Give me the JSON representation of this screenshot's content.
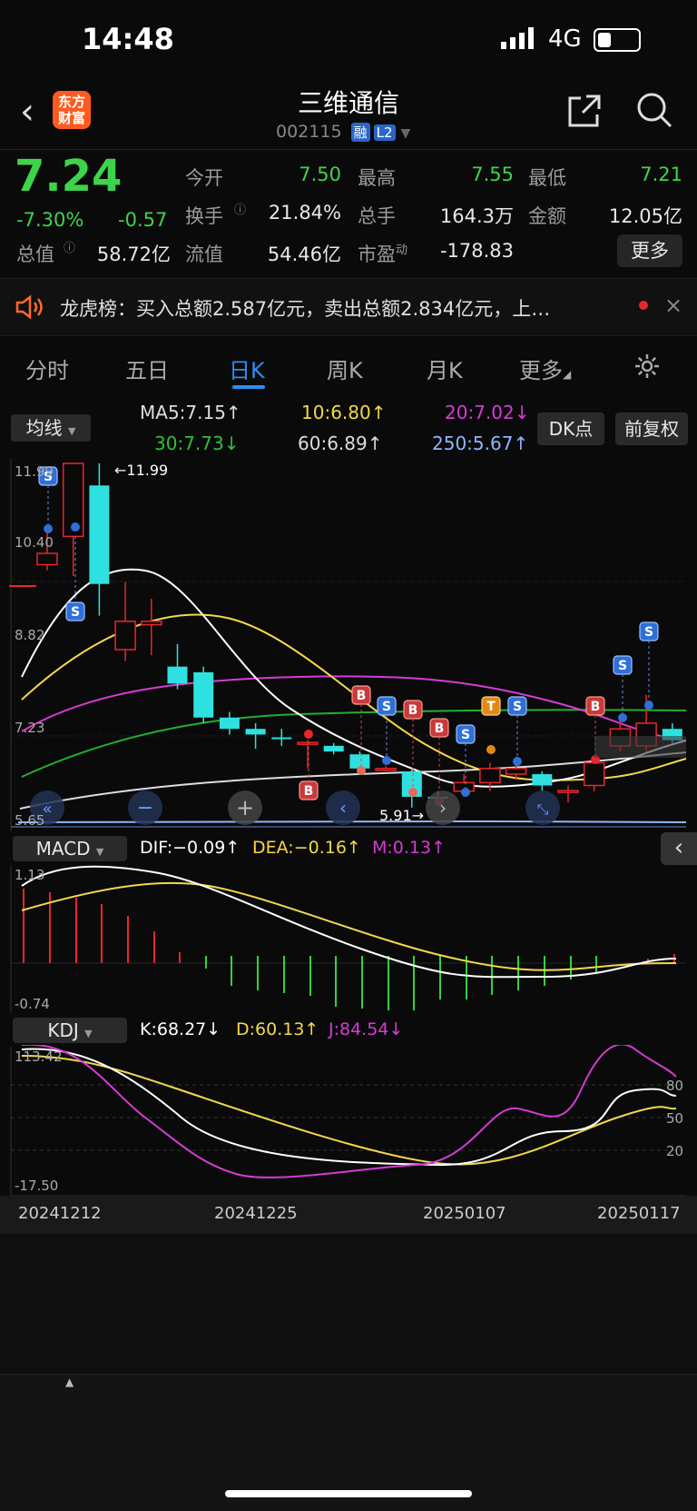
{
  "status": {
    "time": "14:48",
    "network": "4G"
  },
  "header": {
    "logo_text": "东方财富",
    "stock_name": "三维通信",
    "stock_code": "002115",
    "tag_margin": "融",
    "tag_level": "L2"
  },
  "quote": {
    "price": "7.24",
    "change_pct": "-7.30%",
    "change": "-0.57",
    "open_label": "今开",
    "open": "7.50",
    "high_label": "最高",
    "high": "7.55",
    "low_label": "最低",
    "low": "7.21",
    "turnover_label": "换手",
    "turnover": "21.84%",
    "volume_label": "总手",
    "volume": "164.3万",
    "amount_label": "金额",
    "amount": "12.05亿",
    "mktcap_label": "总值",
    "mktcap": "58.72亿",
    "float_label": "流值",
    "float": "54.46亿",
    "pe_label": "市盈",
    "pe_sup": "动",
    "pe": "-178.83",
    "more": "更多"
  },
  "notice": {
    "text": "龙虎榜：买入总额2.587亿元，卖出总额2.834亿元，上…"
  },
  "tabs": [
    {
      "label": "分时"
    },
    {
      "label": "五日"
    },
    {
      "label": "日K"
    },
    {
      "label": "周K"
    },
    {
      "label": "月K"
    },
    {
      "label": "更多"
    }
  ],
  "kchart": {
    "ma_selector": "均线",
    "ma5": "MA5:7.15↑",
    "ma10": "10:6.80↑",
    "ma20": "20:7.02↓",
    "ma30": "30:7.73↓",
    "ma60": "60:6.89↑",
    "ma250": "250:5.67↑",
    "dk_button": "DK点",
    "adjust_button": "前复权",
    "y_labels": [
      "11.99",
      "10.40",
      "8.82",
      "7.23",
      "5.65"
    ],
    "max_note": "←11.99",
    "min_note": "5.91→"
  },
  "macd": {
    "selector": "MACD",
    "dif": "DIF:−0.09↑",
    "dea": "DEA:−0.16↑",
    "m": "M:0.13↑",
    "y_top": "1.13",
    "y_bottom": "-0.74"
  },
  "kdj": {
    "selector": "KDJ",
    "k": "K:68.27↓",
    "d": "D:60.13↑",
    "j": "J:84.54↓",
    "y_top": "113.42",
    "y_bottom": "-17.50",
    "levels": [
      "80",
      "50",
      "20"
    ]
  },
  "dates": [
    "20241212",
    "20241225",
    "20250107",
    "20250117"
  ],
  "chart_data": {
    "type": "candlestick",
    "ylim": [
      5.65,
      11.99
    ],
    "candles": [
      {
        "o": 10.2,
        "c": 10.4,
        "h": 10.9,
        "l": 10.1
      },
      {
        "o": 10.7,
        "c": 11.99,
        "h": 11.99,
        "l": 10.0
      },
      {
        "o": 11.6,
        "c": 9.86,
        "h": 11.99,
        "l": 9.3
      },
      {
        "o": 8.7,
        "c": 9.2,
        "h": 9.9,
        "l": 8.5
      },
      {
        "o": 9.14,
        "c": 9.2,
        "h": 9.6,
        "l": 8.6
      },
      {
        "o": 8.4,
        "c": 8.1,
        "h": 8.8,
        "l": 8.0
      },
      {
        "o": 8.3,
        "c": 7.5,
        "h": 8.4,
        "l": 7.4
      },
      {
        "o": 7.5,
        "c": 7.3,
        "h": 7.6,
        "l": 7.2
      },
      {
        "o": 7.3,
        "c": 7.2,
        "h": 7.4,
        "l": 6.95
      },
      {
        "o": 7.15,
        "c": 7.14,
        "h": 7.3,
        "l": 7.0
      },
      {
        "o": 7.06,
        "c": 7.06,
        "h": 7.1,
        "l": 6.6
      },
      {
        "o": 7.0,
        "c": 6.9,
        "h": 7.05,
        "l": 6.85
      },
      {
        "o": 6.85,
        "c": 6.6,
        "h": 6.9,
        "l": 6.5
      },
      {
        "o": 6.6,
        "c": 6.6,
        "h": 6.65,
        "l": 6.55
      },
      {
        "o": 6.55,
        "c": 6.1,
        "h": 6.6,
        "l": 5.91
      },
      {
        "o": 6.1,
        "c": 6.08,
        "h": 6.2,
        "l": 6.0
      },
      {
        "o": 6.2,
        "c": 6.35,
        "h": 6.5,
        "l": 6.1
      },
      {
        "o": 6.35,
        "c": 6.6,
        "h": 6.7,
        "l": 6.2
      },
      {
        "o": 6.5,
        "c": 6.6,
        "h": 6.8,
        "l": 6.4
      },
      {
        "o": 6.5,
        "c": 6.3,
        "h": 6.55,
        "l": 6.2
      },
      {
        "o": 6.2,
        "c": 6.21,
        "h": 6.3,
        "l": 6.0
      },
      {
        "o": 6.3,
        "c": 6.7,
        "h": 6.8,
        "l": 6.2
      },
      {
        "o": 7.0,
        "c": 7.3,
        "h": 7.5,
        "l": 6.9
      },
      {
        "o": 7.0,
        "c": 7.4,
        "h": 7.9,
        "l": 6.9
      },
      {
        "o": 7.3,
        "c": 7.1,
        "h": 7.4,
        "l": 7.05
      }
    ]
  }
}
